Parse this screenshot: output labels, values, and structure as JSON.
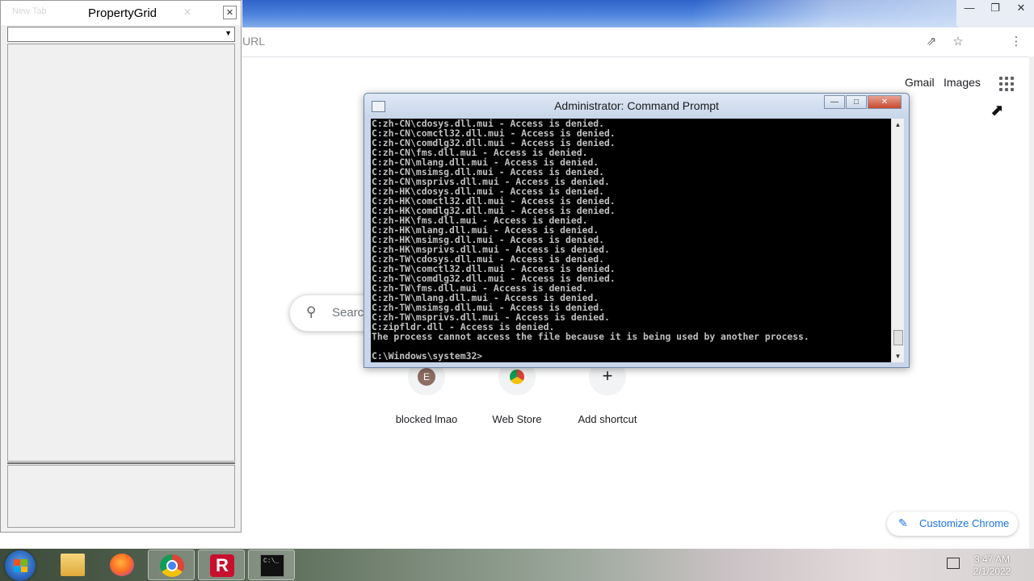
{
  "browser": {
    "omnibox_text": "URL",
    "header_links": [
      "Gmail",
      "Images"
    ],
    "search_placeholder": "Search",
    "shortcuts": [
      {
        "label": "blocked lmao",
        "initial": "E"
      },
      {
        "label": "Web Store"
      },
      {
        "label": "Add shortcut"
      }
    ],
    "customize_label": "Customize Chrome"
  },
  "property_grid": {
    "title": "PropertyGrid",
    "ghost_tab": "New Tab"
  },
  "cmd": {
    "title": "Administrator: Command Prompt",
    "lines": [
      "C:zh-CN\\cdosys.dll.mui - Access is denied.",
      "C:zh-CN\\comctl32.dll.mui - Access is denied.",
      "C:zh-CN\\comdlg32.dll.mui - Access is denied.",
      "C:zh-CN\\fms.dll.mui - Access is denied.",
      "C:zh-CN\\mlang.dll.mui - Access is denied.",
      "C:zh-CN\\msimsg.dll.mui - Access is denied.",
      "C:zh-CN\\msprivs.dll.mui - Access is denied.",
      "C:zh-HK\\cdosys.dll.mui - Access is denied.",
      "C:zh-HK\\comctl32.dll.mui - Access is denied.",
      "C:zh-HK\\comdlg32.dll.mui - Access is denied.",
      "C:zh-HK\\fms.dll.mui - Access is denied.",
      "C:zh-HK\\mlang.dll.mui - Access is denied.",
      "C:zh-HK\\msimsg.dll.mui - Access is denied.",
      "C:zh-HK\\msprivs.dll.mui - Access is denied.",
      "C:zh-TW\\cdosys.dll.mui - Access is denied.",
      "C:zh-TW\\comctl32.dll.mui - Access is denied.",
      "C:zh-TW\\comdlg32.dll.mui - Access is denied.",
      "C:zh-TW\\fms.dll.mui - Access is denied.",
      "C:zh-TW\\mlang.dll.mui - Access is denied.",
      "C:zh-TW\\msimsg.dll.mui - Access is denied.",
      "C:zh-TW\\msprivs.dll.mui - Access is denied.",
      "C:zipfldr.dll - Access is denied.",
      "The process cannot access the file because it is being used by another process.",
      "",
      "C:\\Windows\\system32>"
    ]
  },
  "taskbar": {
    "apps": [
      "File Explorer",
      "Firefox",
      "Google Chrome",
      "R app",
      "Command Prompt"
    ],
    "time": "3:47 AM",
    "date": "2/1/2022"
  }
}
